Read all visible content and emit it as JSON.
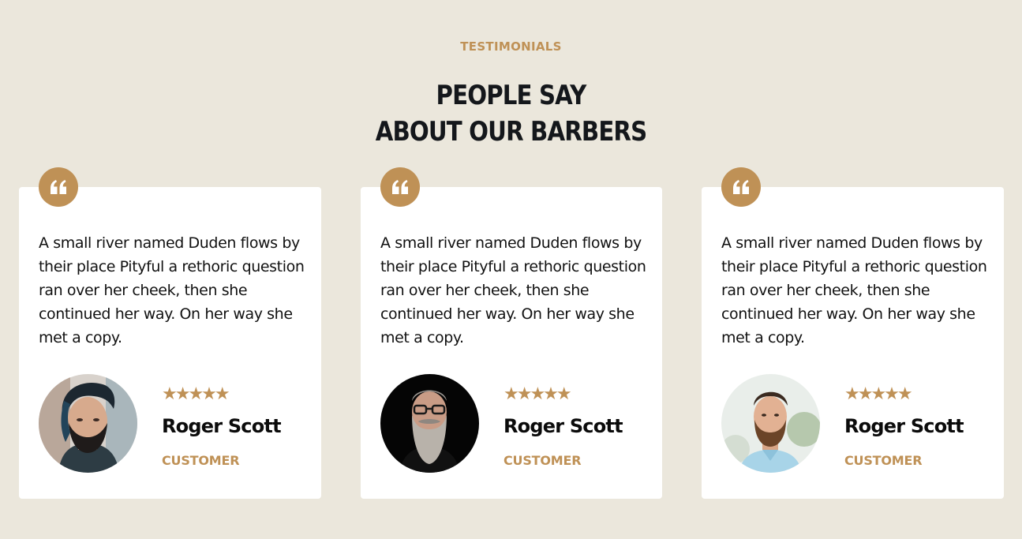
{
  "header": {
    "eyebrow": "TESTIMONIALS",
    "title_line1": "PEOPLE SAY",
    "title_line2": "ABOUT OUR BARBERS"
  },
  "colors": {
    "background": "#ebe7dc",
    "accent": "#bf9156",
    "heading": "#14171b",
    "card": "#ffffff"
  },
  "testimonials": [
    {
      "quote_icon": "quote-icon",
      "text": "A small river named Duden flows by their place Pityful a rethoric question ran over her cheek, then she continued her way. On her way she met a copy.",
      "rating": 5,
      "stars": "★★★★★",
      "name": "Roger Scott",
      "role": "CUSTOMER",
      "avatar": "man-with-undercut-and-beard"
    },
    {
      "quote_icon": "quote-icon",
      "text": "A small river named Duden flows by their place Pityful a rethoric question ran over her cheek, then she continued her way. On her way she met a copy.",
      "rating": 5,
      "stars": "★★★★★",
      "name": "Roger Scott",
      "role": "CUSTOMER",
      "avatar": "man-with-glasses-and-grey-beard"
    },
    {
      "quote_icon": "quote-icon",
      "text": "A small river named Duden flows by their place Pityful a rethoric question ran over her cheek, then she continued her way. On her way she met a copy.",
      "rating": 5,
      "stars": "★★★★★",
      "name": "Roger Scott",
      "role": "CUSTOMER",
      "avatar": "man-in-light-blue-shirt-with-beard"
    }
  ]
}
